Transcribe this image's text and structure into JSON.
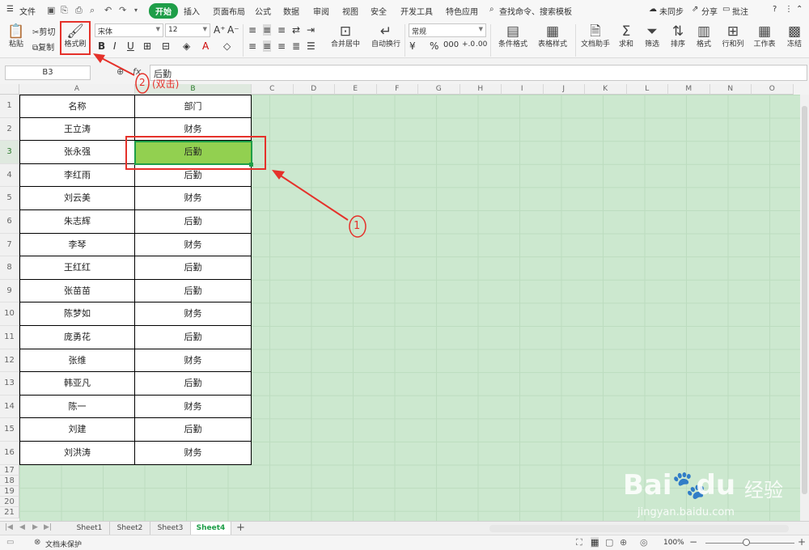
{
  "menu": {
    "file": "文件",
    "tabs": [
      "开始",
      "插入",
      "页面布局",
      "公式",
      "数据",
      "审阅",
      "视图",
      "安全",
      "开发工具",
      "特色应用"
    ],
    "search": "查找命令、搜索模板",
    "sync": "未同步",
    "share": "分享",
    "comment": "批注",
    "help": "?"
  },
  "ribbon": {
    "paste": "粘贴",
    "cut": "剪切",
    "copy": "复制",
    "format_painter": "格式刷",
    "font": "宋体",
    "font_size": "12",
    "number_format": "常规",
    "merge": "合并居中",
    "wrap": "自动换行",
    "cond_format": "条件格式",
    "table_style": "表格样式",
    "doc_helper": "文档助手",
    "sum": "求和",
    "filter": "筛选",
    "sort": "排序",
    "format": "格式",
    "row_col": "行和列",
    "worksheet": "工作表",
    "freeze": "冻结"
  },
  "formula_bar": {
    "name_box": "B3",
    "fx": "fx",
    "value": "后勤"
  },
  "columns": [
    "A",
    "B",
    "C",
    "D",
    "E",
    "F",
    "G",
    "H",
    "I",
    "J",
    "K",
    "L",
    "M",
    "N",
    "O"
  ],
  "rows": [
    "1",
    "2",
    "3",
    "4",
    "5",
    "6",
    "7",
    "8",
    "9",
    "10",
    "11",
    "12",
    "13",
    "14",
    "15",
    "16",
    "17",
    "18",
    "19",
    "20",
    "21"
  ],
  "table": {
    "header": [
      "名称",
      "部门"
    ],
    "data": [
      [
        "王立涛",
        "财务"
      ],
      [
        "张永强",
        "后勤"
      ],
      [
        "李红雨",
        "后勤"
      ],
      [
        "刘云美",
        "财务"
      ],
      [
        "朱志辉",
        "后勤"
      ],
      [
        "李琴",
        "财务"
      ],
      [
        "王红红",
        "后勤"
      ],
      [
        "张苗苗",
        "后勤"
      ],
      [
        "陈梦如",
        "财务"
      ],
      [
        "庞勇花",
        "后勤"
      ],
      [
        "张维",
        "财务"
      ],
      [
        "韩亚凡",
        "后勤"
      ],
      [
        "陈一",
        "财务"
      ],
      [
        "刘建",
        "后勤"
      ],
      [
        "刘洪涛",
        "财务"
      ]
    ]
  },
  "active_cell": "B3",
  "sheets": [
    "Sheet1",
    "Sheet2",
    "Sheet3",
    "Sheet4"
  ],
  "active_sheet": "Sheet4",
  "status": {
    "protect": "文档未保护",
    "zoom": "100%"
  },
  "annotations": {
    "step1": "1",
    "step2": "2",
    "step2_note": "(双击)"
  },
  "watermark": {
    "brand": "Bai",
    "brand2": "du",
    "cn": "经验",
    "url": "jingyan.baidu.com"
  },
  "colors": {
    "accent": "#1e9e48",
    "active_fill": "#92d050",
    "annotation": "#e5312a",
    "sheet_bg": "#cce8cf"
  }
}
